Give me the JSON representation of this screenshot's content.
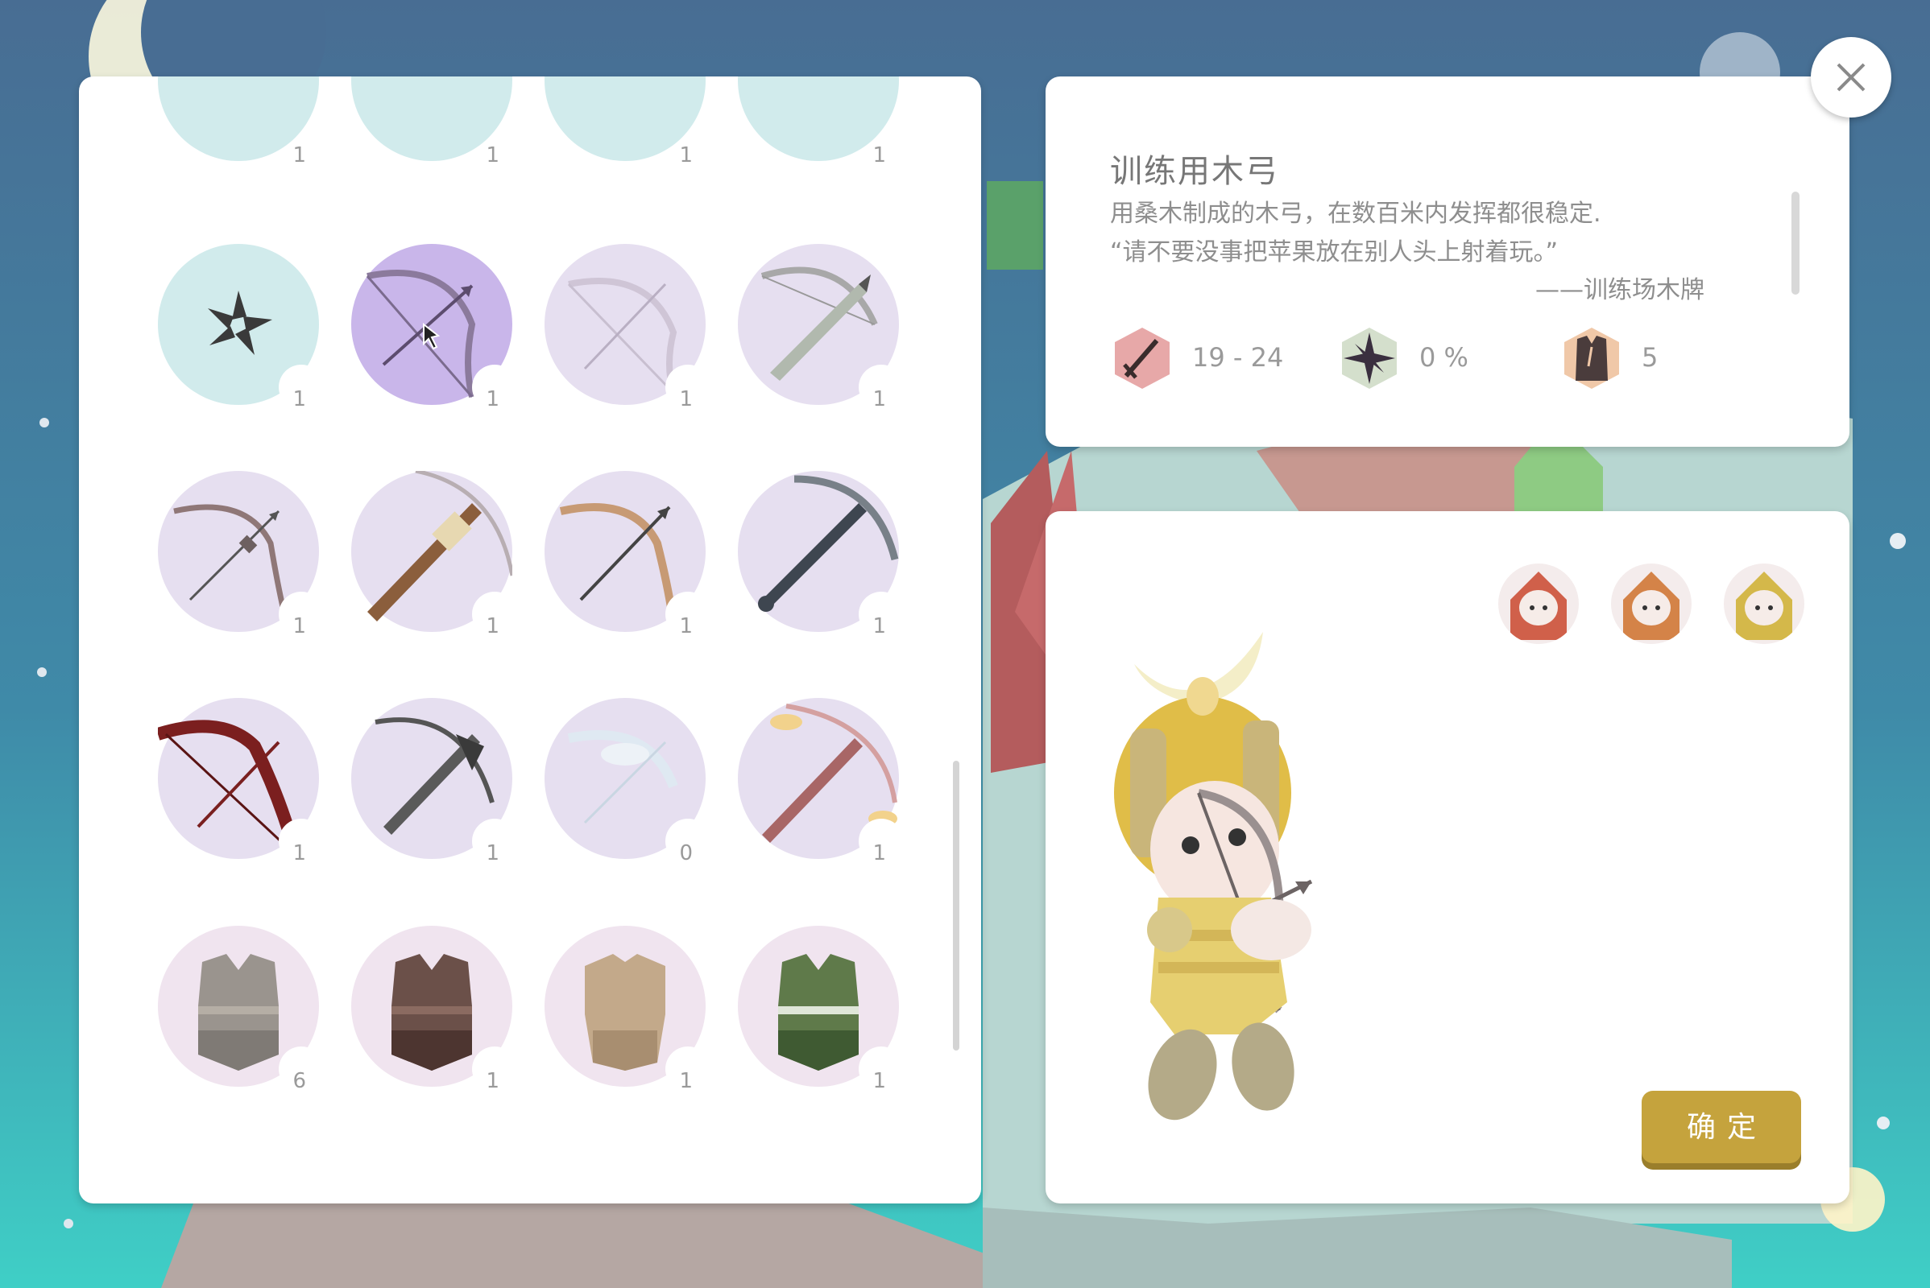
{
  "colors": {
    "accent_gold": "#c5a33d",
    "slot_selected": "#c9b6ea",
    "slot_weapon": "#e6dff0",
    "slot_armor": "#f0e4ef",
    "slot_throwable": "#d1ebec"
  },
  "inventory": {
    "partial_row_qty": [
      "1",
      "1",
      "1",
      "1"
    ],
    "rows": [
      [
        {
          "icon": "shuriken-icon",
          "qty": "1"
        },
        {
          "icon": "training-wood-bow-icon",
          "qty": "1",
          "selected": true
        },
        {
          "icon": "faded-bow-icon",
          "qty": "1"
        },
        {
          "icon": "crossbow-icon",
          "qty": "1"
        }
      ],
      [
        {
          "icon": "recurve-bow-icon",
          "qty": "1"
        },
        {
          "icon": "wooden-crossbow-icon",
          "qty": "1"
        },
        {
          "icon": "spiked-bow-icon",
          "qty": "1"
        },
        {
          "icon": "dark-crossbow-icon",
          "qty": "1"
        }
      ],
      [
        {
          "icon": "dragon-wing-bow-icon",
          "qty": "1"
        },
        {
          "icon": "shadow-crossbow-icon",
          "qty": "1"
        },
        {
          "icon": "angel-wing-bow-icon",
          "qty": "0"
        },
        {
          "icon": "flame-crossbow-icon",
          "qty": "1"
        }
      ],
      [
        {
          "icon": "gray-armor-icon",
          "qty": "6"
        },
        {
          "icon": "brown-armor-icon",
          "qty": "1"
        },
        {
          "icon": "tan-armor-icon",
          "qty": "1"
        },
        {
          "icon": "green-armor-icon",
          "qty": "1"
        }
      ]
    ]
  },
  "item": {
    "name": "训练用木弓",
    "desc_line1": "用桑木制成的木弓，在数百米内发挥都很稳定.",
    "desc_line2": "“请不要没事把苹果放在别人头上射着玩。”",
    "desc_source": "——训练场木牌",
    "stats": {
      "damage": {
        "icon": "sword-icon",
        "value": "19 - 24"
      },
      "crit": {
        "icon": "star-burst-icon",
        "value": "0 %"
      },
      "defense": {
        "icon": "vest-icon",
        "value": "5"
      }
    }
  },
  "preview": {
    "characters": [
      "red-hood-character-icon",
      "orange-hood-character-icon",
      "gold-hood-character-icon"
    ],
    "confirm_label": "确定"
  },
  "close_icon": "close-icon"
}
